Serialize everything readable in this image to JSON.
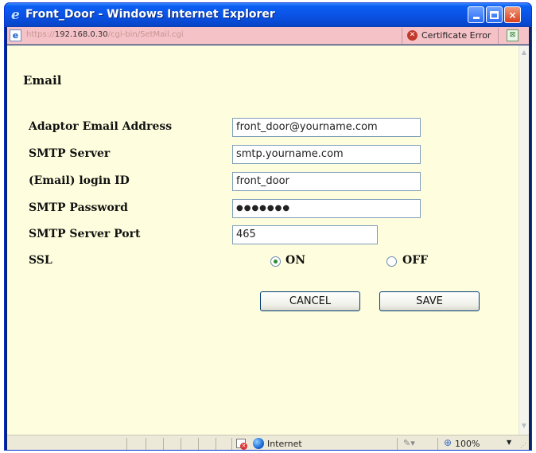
{
  "window": {
    "title": "Front_Door - Windows Internet Explorer",
    "minimize_icon": "minimize-icon",
    "maximize_icon": "maximize-icon",
    "close_label": "×"
  },
  "address_bar": {
    "url_prefix": "https://",
    "url_host": "192.168.0.30",
    "url_path": "/cgi-bin/SetMail.cgi",
    "cert_error": "Certificate Error"
  },
  "page": {
    "heading": "Email",
    "fields": [
      {
        "label": "Adaptor Email Address",
        "value": "front_door@yourname.com"
      },
      {
        "label": "SMTP Server",
        "value": "smtp.yourname.com"
      },
      {
        "label": "(Email) login ID",
        "value": "front_door"
      },
      {
        "label": "SMTP Password",
        "value": "●●●●●●●"
      },
      {
        "label": "SMTP Server Port",
        "value": "465"
      }
    ],
    "ssl": {
      "label": "SSL",
      "options": [
        "ON",
        "OFF"
      ],
      "selected": "ON"
    },
    "buttons": {
      "cancel": "CANCEL",
      "save": "SAVE"
    }
  },
  "status_bar": {
    "zone": "Internet",
    "zoom": "100%"
  },
  "colors": {
    "title_bar": "#0a53e6",
    "address_bar_error": "#f5c2c7",
    "page_background": "#fefede",
    "radio_selected": "#2f8a2f"
  }
}
